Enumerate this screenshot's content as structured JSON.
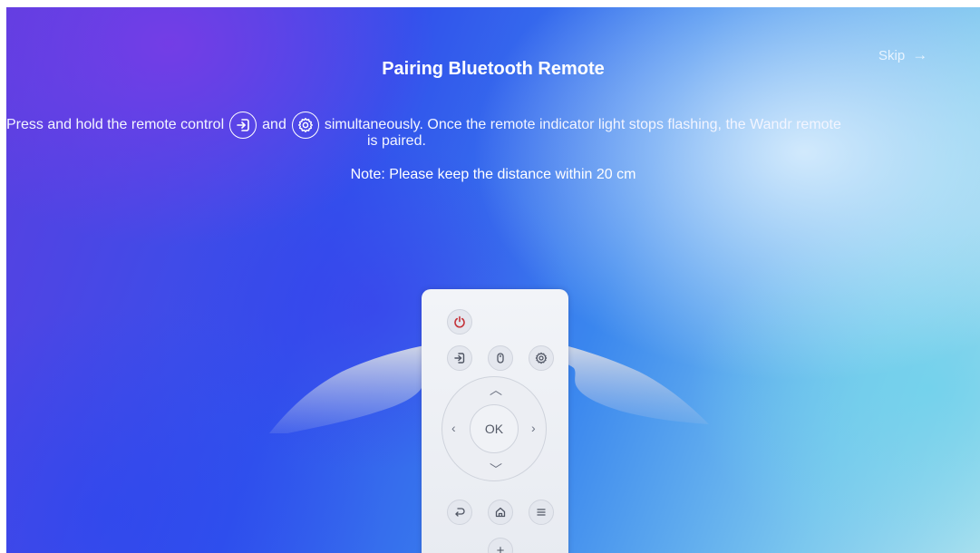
{
  "header": {
    "title": "Pairing Bluetooth Remote",
    "skip_label": "Skip",
    "skip_icon": "arrow-right-icon"
  },
  "instructions": {
    "part1": "Press and hold the remote control",
    "icon1": "input-source-icon",
    "part2": "and",
    "icon2": "settings-gear-icon",
    "part3": "simultaneously. Once the remote indicator light stops flashing, the Wandr remote",
    "part4": "is paired."
  },
  "note": "Note: Please keep the distance within 20 cm",
  "remote": {
    "ok_label": "OK",
    "plus_label": "+",
    "buttons": [
      "power-icon",
      "input-source-icon",
      "mouse-icon",
      "settings-gear-icon",
      "chevron-up-icon",
      "chevron-left-icon",
      "chevron-right-icon",
      "chevron-down-icon",
      "back-icon",
      "home-icon",
      "menu-icon"
    ],
    "power_color": "#c4333a"
  }
}
